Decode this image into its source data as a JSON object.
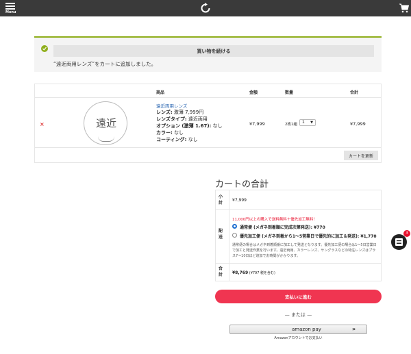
{
  "header": {
    "menu_label": "Menu",
    "logo_icon": "refresh-logo-icon",
    "cart_icon": "cart-icon"
  },
  "notice": {
    "continue_label": "買い物を続ける",
    "message": "“遠近両用レンズ”をカートに追加しました。",
    "accent": "#8fae1b"
  },
  "cart_table": {
    "headers": {
      "product": "商品",
      "price": "金額",
      "quantity": "数量",
      "subtotal": "合計"
    },
    "item": {
      "remove": "×",
      "thumb_text": "遠近",
      "name": "遠近両用レンズ",
      "details": [
        {
          "label": "レンズ:",
          "value": " 激薄 7,999円"
        },
        {
          "label": "レンズタイプ:",
          "value": " 遠近両用"
        },
        {
          "label": "オプション (激薄 1.67):",
          "value": " なし"
        },
        {
          "label": "カラー:",
          "value": " なし"
        },
        {
          "label": "コーティング:",
          "value": " なし"
        }
      ],
      "price": "¥7,999",
      "qty_label": "2枚1組",
      "qty_value": "1",
      "subtotal": "¥7,999"
    },
    "update_label": "カートを更新"
  },
  "totals": {
    "title": "カートの合計",
    "subtotal_label": "小計",
    "subtotal_value": "¥7,999",
    "shipping_label": "配送",
    "promo": "11,000円以上の購入で送料無料＋優先加工無料！",
    "options": [
      {
        "label": "通常便 (メガネ到着順に完成次第発送): ¥770",
        "selected": true
      },
      {
        "label": "優先加工便 (メガネ到着から1～5営業日で優先的に加工＆発送): ¥1,770",
        "selected": false
      }
    ],
    "note": "通常便の場合はメガネ到着順番に加工して発送となります。優先加工便の場合は1～5日営業日で加工と発送作業を行います。遠近両用、カラーレンズ、サングラスなどの特注レンズはプラス7～10日ほど追加でお時間がかかります。",
    "total_label": "合計",
    "total_value": "¥8,769",
    "tax_note": " (¥797 税を含む)"
  },
  "checkout": {
    "button_label": "支払いに進む",
    "or_label": "— または —",
    "amazon_label": "amazon pay",
    "amazon_arrow": "»",
    "amazon_sub": "Amazonアカウントでお支払い"
  },
  "chat": {
    "badge": "3",
    "colors": {
      "button": "#222222",
      "badge": "#e8112d"
    }
  },
  "colors": {
    "checkout": "#f03551",
    "link": "#2a66b1",
    "promo": "#e8112d"
  }
}
